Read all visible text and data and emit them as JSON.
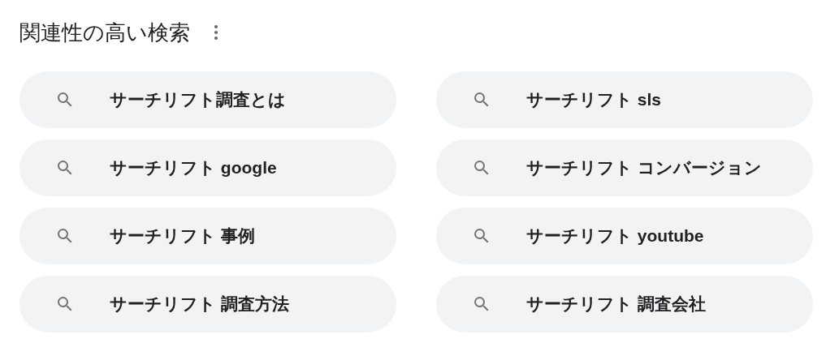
{
  "heading": "関連性の高い検索",
  "suggestions": [
    {
      "text": "サーチリフト調査とは"
    },
    {
      "text": "サーチリフト sls"
    },
    {
      "text": "サーチリフト google"
    },
    {
      "text": "サーチリフト コンバージョン"
    },
    {
      "text": "サーチリフト 事例"
    },
    {
      "text": "サーチリフト youtube"
    },
    {
      "text": "サーチリフト 調査方法"
    },
    {
      "text": "サーチリフト 調査会社"
    }
  ]
}
